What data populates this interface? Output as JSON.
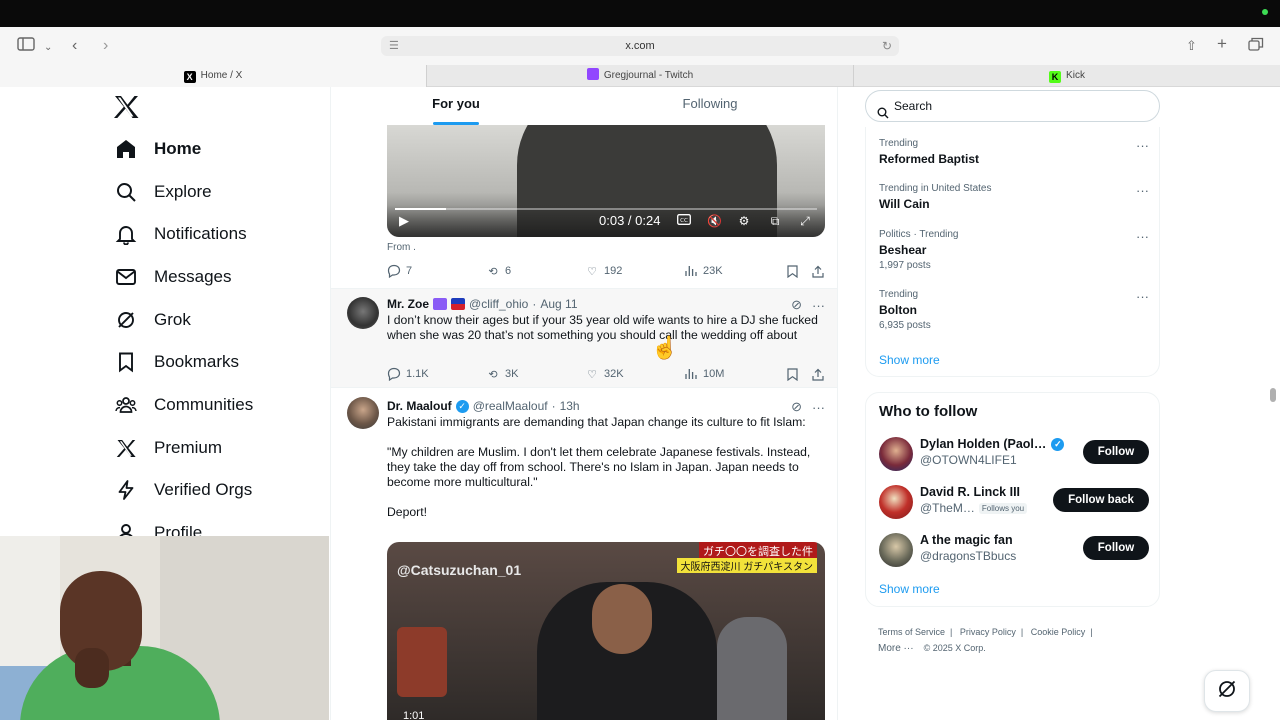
{
  "browser": {
    "url": "x.com",
    "tabs": [
      {
        "label": "Home / X",
        "favicon": "X"
      },
      {
        "label": "Gregjournal - Twitch",
        "favicon": "twitch"
      },
      {
        "label": "Kick",
        "favicon": "K"
      }
    ]
  },
  "sidebar": {
    "items": [
      {
        "label": "Home",
        "icon": "home-icon"
      },
      {
        "label": "Explore",
        "icon": "search-icon"
      },
      {
        "label": "Notifications",
        "icon": "bell-icon"
      },
      {
        "label": "Messages",
        "icon": "envelope-icon"
      },
      {
        "label": "Grok",
        "icon": "grok-icon"
      },
      {
        "label": "Bookmarks",
        "icon": "bookmark-icon"
      },
      {
        "label": "Communities",
        "icon": "people-icon"
      },
      {
        "label": "Premium",
        "icon": "x-icon"
      },
      {
        "label": "Verified Orgs",
        "icon": "bolt-icon"
      },
      {
        "label": "Profile",
        "icon": "person-icon"
      }
    ]
  },
  "feed": {
    "tabs": [
      "For you",
      "Following"
    ],
    "video1": {
      "time": "0:03 / 0:24",
      "progress": 0.12
    },
    "from_label": "From .",
    "post0_stats": {
      "replies": "7",
      "reposts": "6",
      "likes": "192",
      "views": "23K"
    },
    "posts": [
      {
        "name": "Mr. Zoe",
        "handle": "@cliff_ohio",
        "time": "Aug 11",
        "text": "I don’t know their ages but if your 35 year old wife wants to hire a DJ she fucked when she was 20 that’s not something you should call the wedding off about",
        "replies": "1.1K",
        "reposts": "3K",
        "likes": "32K",
        "views": "10M"
      },
      {
        "name": "Dr. Maalouf",
        "handle": "@realMaalouf",
        "time": "13h",
        "text": "Pakistani immigrants are demanding that Japan change its culture to fit Islam:\n\n\"My children are Muslim. I don't let them celebrate Japanese festivals. Instead, they take the day off from school. There's no Islam in Japan. Japan needs to become more multicultural.\"\n\nDeport!"
      }
    ],
    "video2": {
      "watermark": "@Catsuzuchan_01",
      "caption_top": "ガチ〇〇を調査した件",
      "caption_sub": "大阪府西淀川 ガチパキスタン",
      "duration": "1:01"
    }
  },
  "right": {
    "search_placeholder": "Search",
    "trends": [
      {
        "context": "Trending",
        "title": "Reformed Baptist",
        "count": ""
      },
      {
        "context": "Trending in United States",
        "title": "Will Cain",
        "count": ""
      },
      {
        "context": "Politics · Trending",
        "title": "Beshear",
        "count": "1,997 posts"
      },
      {
        "context": "Trending",
        "title": "Bolton",
        "count": "6,935 posts"
      }
    ],
    "show_more": "Show more",
    "who_to_follow": {
      "title": "Who to follow",
      "users": [
        {
          "name": "Dylan Holden (Paol…",
          "handle": "@OTOWN4LIFE1",
          "button": "Follow",
          "follows_you": ""
        },
        {
          "name": "David R. Linck III",
          "handle": "@TheM…",
          "button": "Follow back",
          "follows_you": "Follows you"
        },
        {
          "name": "A the magic fan",
          "handle": "@dragonsTBbucs",
          "button": "Follow",
          "follows_you": ""
        }
      ],
      "show_more": "Show more"
    },
    "footer": {
      "links": [
        "Terms of Service",
        "Privacy Policy",
        "Cookie Policy"
      ],
      "more": "More ···",
      "copyright": "© 2025 X Corp."
    }
  },
  "colors": {
    "accent": "#1d9bf0",
    "text": "#0f1419",
    "muted": "#536471"
  }
}
